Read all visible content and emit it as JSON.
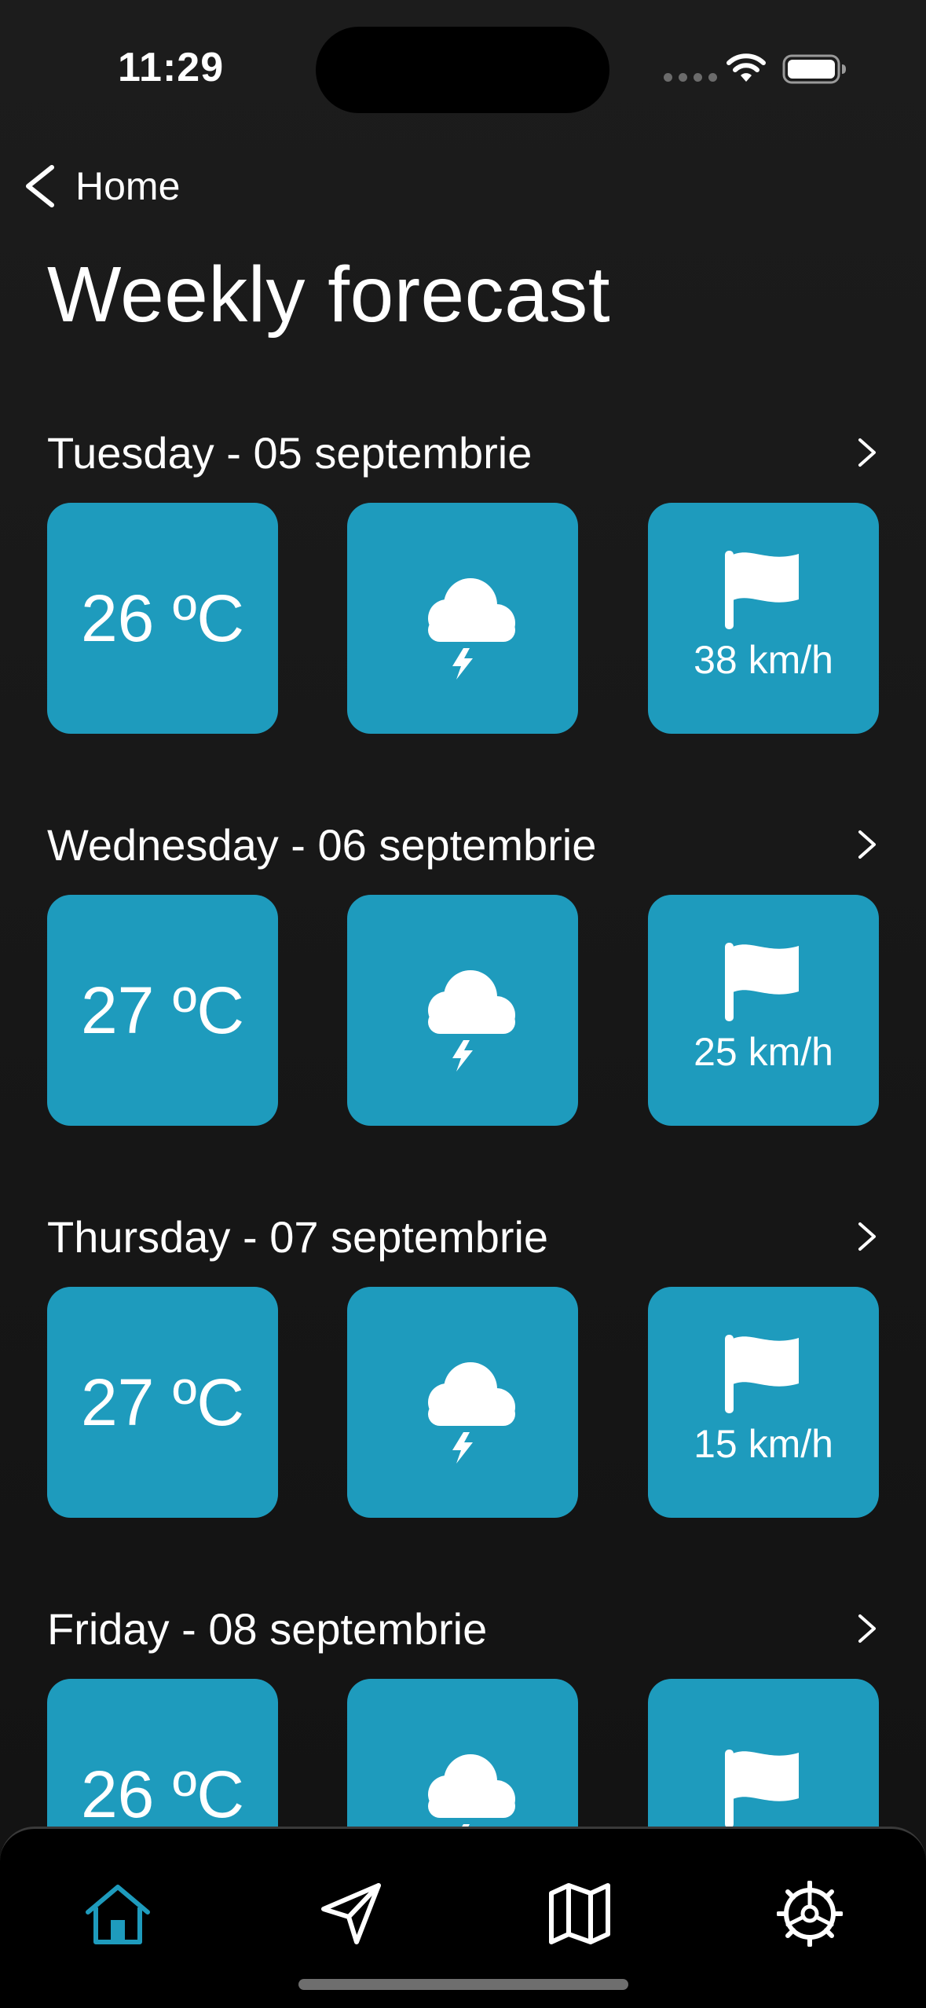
{
  "status_bar": {
    "time": "11:29"
  },
  "nav": {
    "back_label": "Home"
  },
  "title": "Weekly forecast",
  "colors": {
    "card": "#1e9bbd",
    "active_tab": "#1e9bbd",
    "background": "#1a1a1a"
  },
  "days": [
    {
      "title": "Tuesday - 05 septembrie",
      "temperature": "26 ºC",
      "condition_icon": "thunderstorm-icon",
      "wind": "38 km/h"
    },
    {
      "title": "Wednesday - 06 septembrie",
      "temperature": "27 ºC",
      "condition_icon": "thunderstorm-icon",
      "wind": "25 km/h"
    },
    {
      "title": "Thursday - 07 septembrie",
      "temperature": "27 ºC",
      "condition_icon": "thunderstorm-icon",
      "wind": "15 km/h"
    },
    {
      "title": "Friday - 08 septembrie",
      "temperature": "26 ºC",
      "condition_icon": "thunderstorm-icon",
      "wind": ""
    }
  ],
  "tabs": [
    {
      "icon": "home-icon",
      "active": true
    },
    {
      "icon": "send-icon",
      "active": false
    },
    {
      "icon": "map-icon",
      "active": false
    },
    {
      "icon": "settings-icon",
      "active": false
    }
  ]
}
